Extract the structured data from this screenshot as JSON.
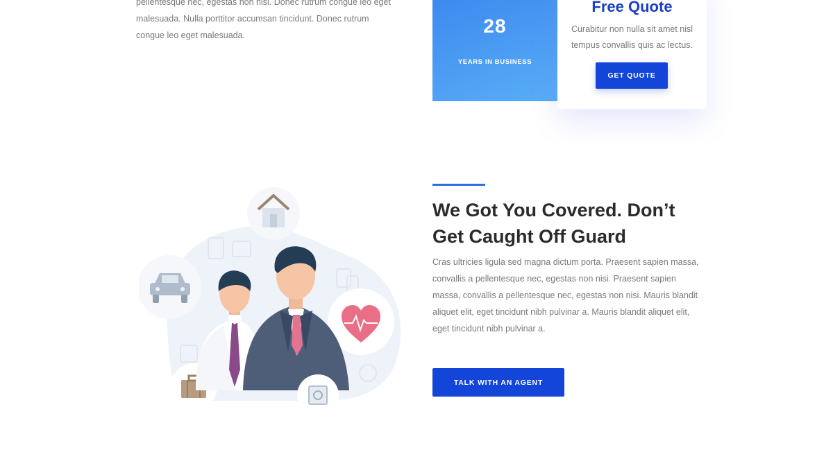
{
  "intro": {
    "paragraph": "pellentesque nec, egestas non nisi. Donec rutrum congue leo eget malesuada. Nulla porttitor accumsan tincidunt. Donec rutrum congue leo eget malesuada."
  },
  "stats": {
    "number": "28",
    "label": "YEARS IN BUSINESS",
    "gradient_start": "#3a86ef",
    "gradient_end": "#58aef6"
  },
  "quote": {
    "title": "Free Quote",
    "text": "Curabitur non nulla sit amet nisl tempus convallis quis ac lectus.",
    "button_label": "GET QUOTE"
  },
  "illustration": {
    "icons": [
      "house-icon",
      "car-icon",
      "heart-icon",
      "briefcase-icon",
      "safe-icon"
    ]
  },
  "content": {
    "headline": "We Got You Covered. Don’t Get Caught Off Guard",
    "body": "Cras ultricies ligula sed magna dictum porta. Praesent sapien massa, convallis a pellentesque nec, egestas non nisi. Praesent sapien massa, convallis a pellentesque nec, egestas non nisi. Mauris blandit aliquet elit, eget tincidunt nibh pulvinar a. Mauris blandit aliquet elit, eget tincidunt nibh pulvinar a.",
    "button_label": "TALK WITH AN AGENT"
  },
  "colors": {
    "accent": "#1245d8",
    "title_blue": "#1a3fc4",
    "heading": "#2b2b2b",
    "text": "#7a7a7a"
  }
}
